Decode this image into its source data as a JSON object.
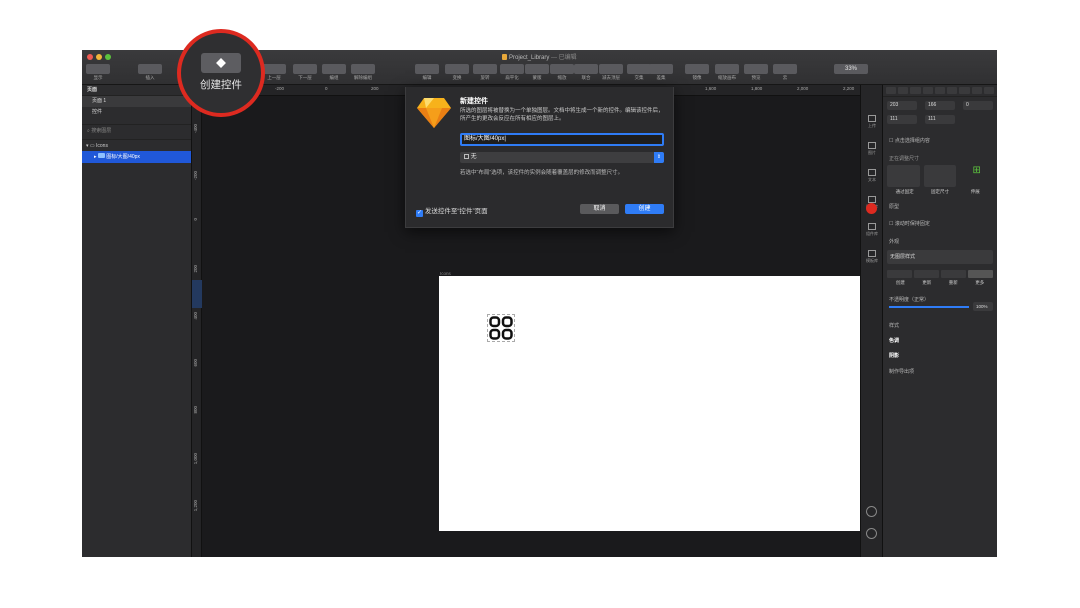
{
  "window": {
    "title": "Project_Library",
    "title_suffix": "— 已编辑"
  },
  "toolbar": {
    "items": [
      {
        "label": "显示"
      },
      {
        "label": "插入"
      },
      {
        "label": "上一层"
      },
      {
        "label": "下一层"
      },
      {
        "label": "编组"
      },
      {
        "label": "解除编组"
      },
      {
        "label": "创建控件"
      },
      {
        "label": "编辑"
      },
      {
        "label": "变换"
      },
      {
        "label": "旋转"
      },
      {
        "label": "扁平化"
      },
      {
        "label": "蒙版"
      },
      {
        "label": "缩放"
      },
      {
        "label": "联合"
      },
      {
        "label": "减去顶层"
      },
      {
        "label": "交集"
      },
      {
        "label": "差集"
      },
      {
        "label": "镜像"
      },
      {
        "label": "缩放画布"
      },
      {
        "label": "预览"
      },
      {
        "label": "云"
      }
    ],
    "zoom": "33%"
  },
  "callout": {
    "label": "创建控件"
  },
  "left_panel": {
    "pages_header": "页面",
    "pages": [
      "页面 1",
      "控件"
    ],
    "search_placeholder": "搜索图层",
    "layers": [
      {
        "name": "Icons"
      },
      {
        "name": "图标/大图/40px"
      }
    ]
  },
  "canvas": {
    "ruler_top": [
      "-200",
      "0",
      "200",
      "1,600",
      "1,800",
      "2,000",
      "2,200"
    ],
    "ruler_left": [
      "-400",
      "-200",
      "0",
      "200",
      "400",
      "600",
      "800",
      "1,000",
      "1,200"
    ],
    "cursor_readout": "0",
    "artboard_label": "Icons"
  },
  "dialog": {
    "title": "新建控件",
    "description": "所选的图层将被替换为一个单独图层。文档中将生成一个新的控件。编辑该控件后，所产生的更改会反应在所有相应的图层上。",
    "name_value": "图标/大图/40px",
    "layout_select": "无",
    "layout_hint": "若选中“布局”选项，该控件的实例会随着覆盖层的修改而调整尺寸。",
    "checkbox_label": "发送控件至“控件”页面",
    "cancel": "取消",
    "create": "创建"
  },
  "inspector": {
    "position": {
      "x": "203",
      "y": "166",
      "rotation": "0"
    },
    "size": {
      "w": "111",
      "h": "111"
    },
    "clip_label": "点击选择组内容",
    "resize_header": "正在调整尺寸",
    "resize_options": [
      "通过固定",
      "固定尺寸",
      "伸展"
    ],
    "prototype": "原型",
    "prototype_check": "滚动时保持固定",
    "appearance": "外观",
    "style_select": "无图层样式",
    "style_buttons": [
      "创建",
      "更新",
      "重新",
      "更多"
    ],
    "opacity_label": "不透明度（正常）",
    "opacity_value": "100%",
    "style_section": "样式",
    "fill": "色调",
    "shadow": "阴影",
    "export": "制作导出项"
  },
  "strip_tools": [
    "上传",
    "图片",
    "文本",
    "图标库",
    "组件库",
    "模板库"
  ],
  "colors": {
    "accent": "#2f7cf6",
    "danger": "#dd2a20",
    "highlight": "#2058d8"
  }
}
